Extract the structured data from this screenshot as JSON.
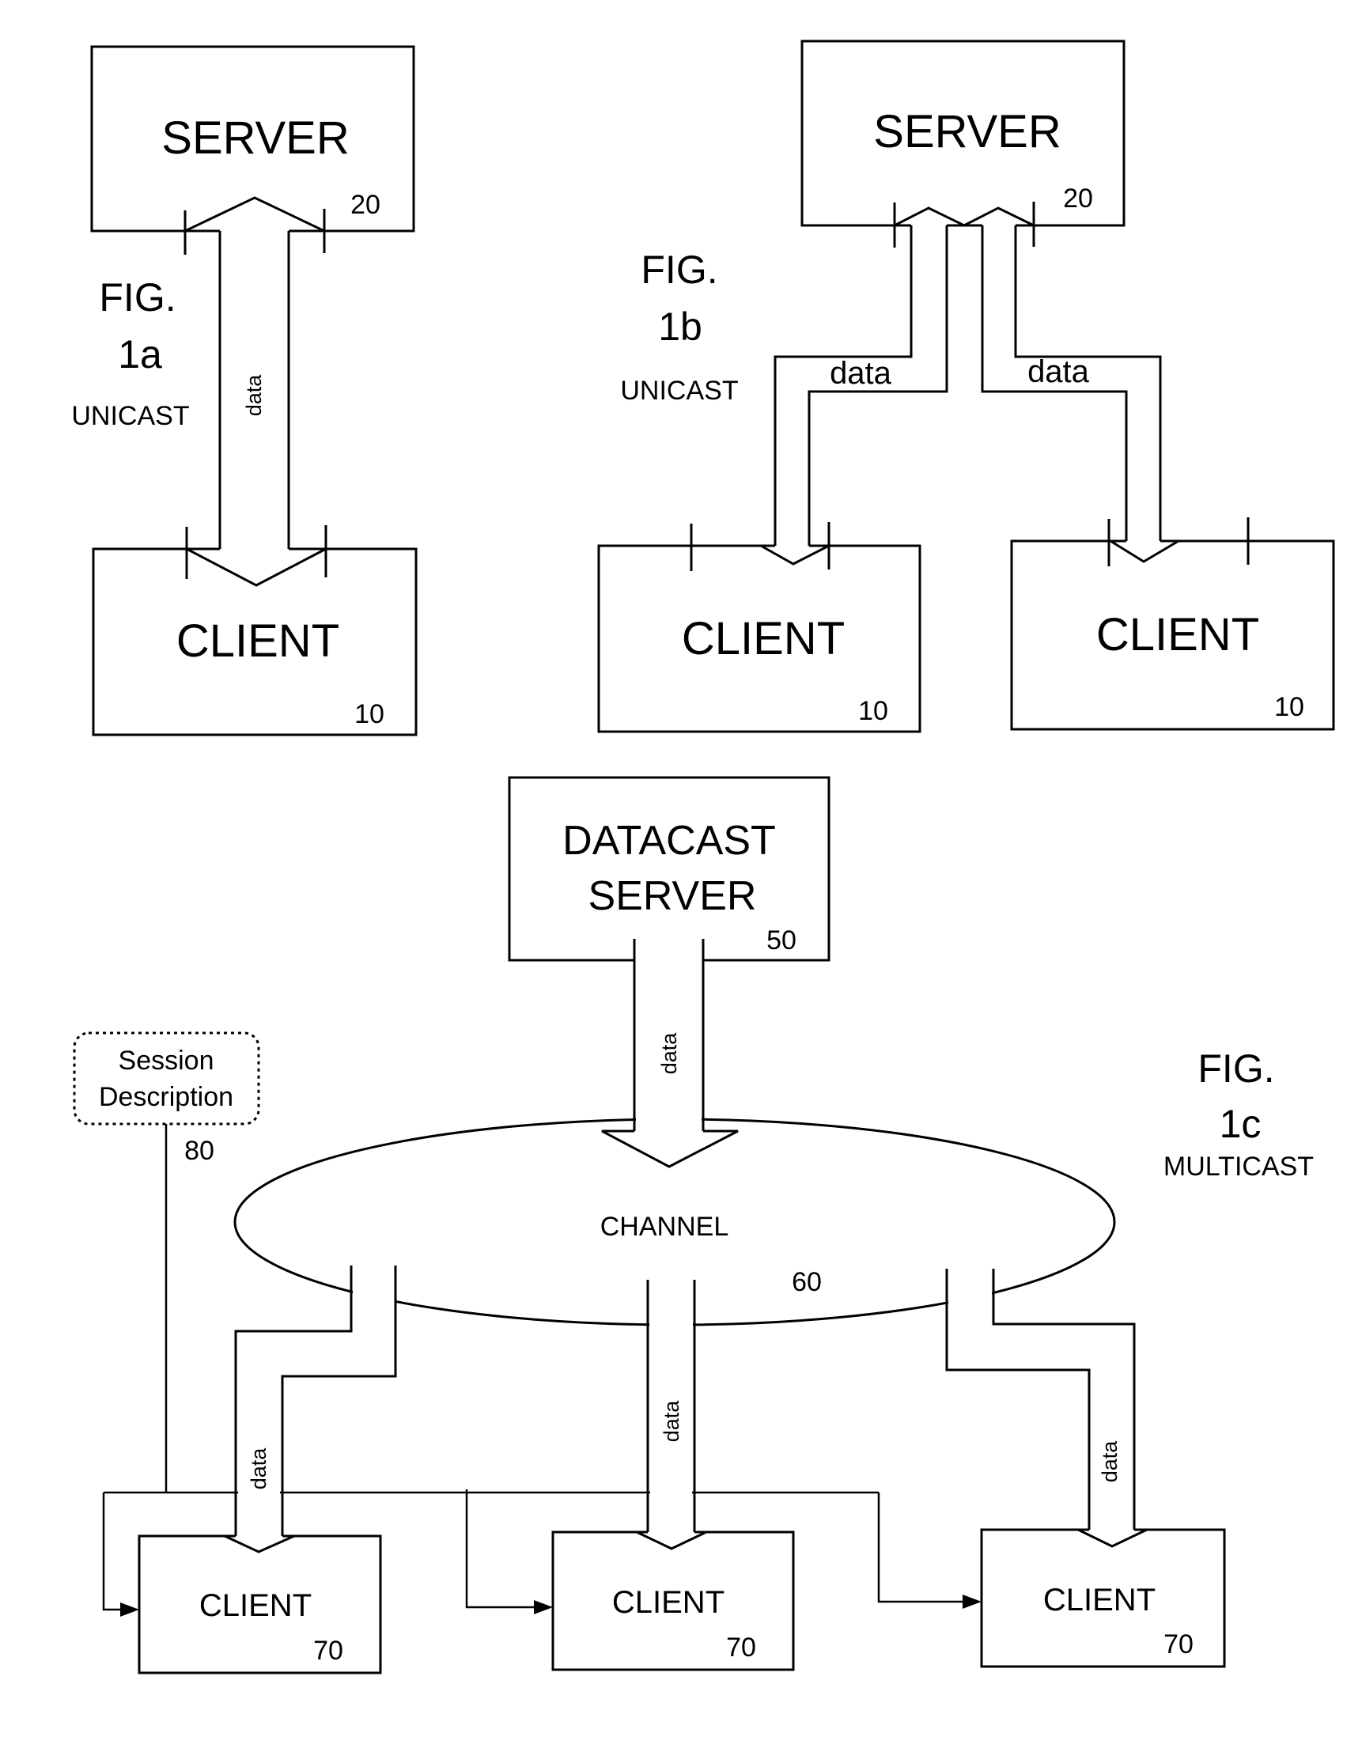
{
  "fig1a": {
    "fig_label": "FIG.",
    "fig_number": "1a",
    "caption": "UNICAST",
    "server": {
      "label": "SERVER",
      "ref": "20"
    },
    "client": {
      "label": "CLIENT",
      "ref": "10"
    },
    "link_label": "data"
  },
  "fig1b": {
    "fig_label": "FIG.",
    "fig_number": "1b",
    "caption": "UNICAST",
    "server": {
      "label": "SERVER",
      "ref": "20"
    },
    "clients": [
      {
        "label": "CLIENT",
        "ref": "10"
      },
      {
        "label": "CLIENT",
        "ref": "10"
      }
    ],
    "link_labels": [
      "data",
      "data"
    ]
  },
  "fig1c": {
    "fig_label": "FIG.",
    "fig_number": "1c",
    "caption": "MULTICAST",
    "server": {
      "label_line1": "DATACAST",
      "label_line2": "SERVER",
      "ref": "50"
    },
    "server_link_label": "data",
    "channel": {
      "label": "CHANNEL",
      "ref": "60"
    },
    "session": {
      "line1": "Session",
      "line2": "Description",
      "ref": "80"
    },
    "clients": [
      {
        "label": "CLIENT",
        "ref": "70",
        "link_label": "data"
      },
      {
        "label": "CLIENT",
        "ref": "70",
        "link_label": "data"
      },
      {
        "label": "CLIENT",
        "ref": "70",
        "link_label": "data"
      }
    ]
  }
}
